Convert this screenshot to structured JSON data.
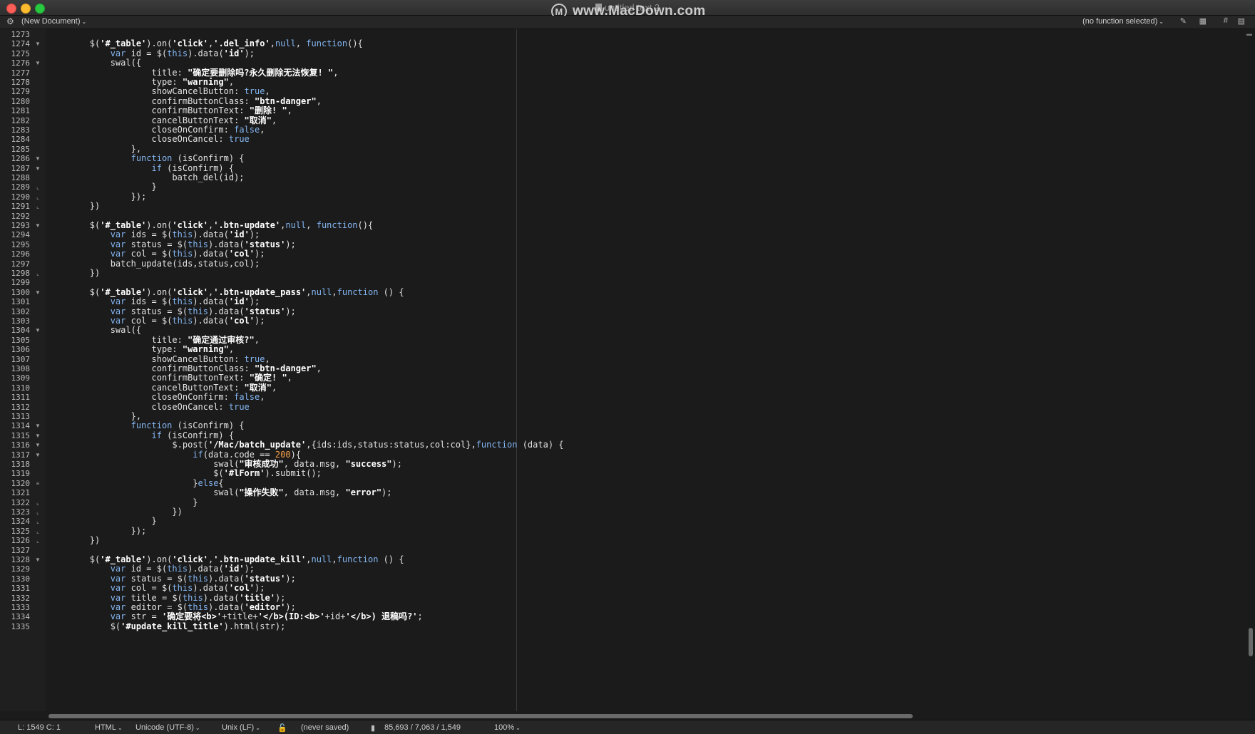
{
  "window": {
    "title": "untitled text 2",
    "watermark": "www.MacDown.com",
    "watermark_logo": "M"
  },
  "navbar": {
    "gear_icon": "⚙",
    "document_menu": "(New Document)",
    "function_menu": "(no function selected)",
    "tools": [
      "✎",
      "▦",
      "#",
      "▤"
    ]
  },
  "colors": {
    "background": "#1b1b1b",
    "keyword": "#84b6f2",
    "string": "#ffffff",
    "number": "#f5a04a",
    "gutter_text": "#bdbdbd"
  },
  "code": {
    "first_line": 1273,
    "lines": [
      "",
      "        $('#_table').on('click','.del_info',null, function(){",
      "            var id = $(this).data('id');",
      "            swal({",
      "                    title: \"确定要删除吗?永久删除无法恢复! \",",
      "                    type: \"warning\",",
      "                    showCancelButton: true,",
      "                    confirmButtonClass: \"btn-danger\",",
      "                    confirmButtonText: \"删除! \",",
      "                    cancelButtonText: \"取消\",",
      "                    closeOnConfirm: false,",
      "                    closeOnCancel: true",
      "                },",
      "                function (isConfirm) {",
      "                    if (isConfirm) {",
      "                        batch_del(id);",
      "                    }",
      "                });",
      "        })",
      "",
      "        $('#_table').on('click','.btn-update',null, function(){",
      "            var ids = $(this).data('id');",
      "            var status = $(this).data('status');",
      "            var col = $(this).data('col');",
      "            batch_update(ids,status,col);",
      "        })",
      "",
      "        $('#_table').on('click','.btn-update_pass',null,function () {",
      "            var ids = $(this).data('id');",
      "            var status = $(this).data('status');",
      "            var col = $(this).data('col');",
      "            swal({",
      "                    title: \"确定通过审核?\",",
      "                    type: \"warning\",",
      "                    showCancelButton: true,",
      "                    confirmButtonClass: \"btn-danger\",",
      "                    confirmButtonText: \"确定! \",",
      "                    cancelButtonText: \"取消\",",
      "                    closeOnConfirm: false,",
      "                    closeOnCancel: true",
      "                },",
      "                function (isConfirm) {",
      "                    if (isConfirm) {",
      "                        $.post('/Mac/batch_update',{ids:ids,status:status,col:col},function (data) {",
      "                            if(data.code == 200){",
      "                                swal(\"审核成功\", data.msg, \"success\");",
      "                                $('#lForm').submit();",
      "                            }else{",
      "                                swal(\"操作失败\", data.msg, \"error\");",
      "                            }",
      "                        })",
      "                    }",
      "                });",
      "        })",
      "",
      "        $('#_table').on('click','.btn-update_kill',null,function () {",
      "            var id = $(this).data('id');",
      "            var status = $(this).data('status');",
      "            var col = $(this).data('col');",
      "            var title = $(this).data('title');",
      "            var editor = $(this).data('editor');",
      "            var str = '确定要将<b>'+title+'</b>(ID:<b>'+id+'</b>) 退稿吗?';",
      "            $('#update_kill_title').html(str);"
    ],
    "folds": {
      "1274": "▼",
      "1276": "▼",
      "1286": "▼",
      "1287": "▼",
      "1289": "⌞",
      "1290": "⌞",
      "1291": "⌞",
      "1293": "▼",
      "1298": "⌞",
      "1300": "▼",
      "1304": "▼",
      "1314": "▼",
      "1315": "▼",
      "1316": "▼",
      "1317": "▼",
      "1320": "≡",
      "1322": "⌞",
      "1323": "⌞",
      "1324": "⌞",
      "1325": "⌞",
      "1326": "⌞",
      "1328": "▼"
    }
  },
  "statusbar": {
    "position": "L: 1549 C: 1",
    "language": "HTML",
    "encoding": "Unicode (UTF-8)",
    "line_endings": "Unix (LF)",
    "lock_icon": "🔓",
    "save_state": "(never saved)",
    "doc_icon": "▮",
    "stats": "85,693 / 7,063 / 1,549",
    "zoom": "100%"
  }
}
